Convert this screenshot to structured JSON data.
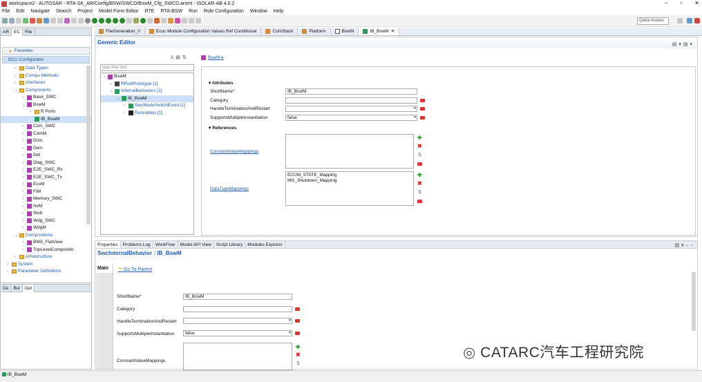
{
  "window": {
    "title": "workspace2 - AUTOSAR - RTA-SK_AR/Config/BSW/SWCD/BswM_Cfg_SWCD.arxml - ISOLAR-AB 4.0.2",
    "controls": [
      "–",
      "▫",
      "✕"
    ]
  },
  "menu": [
    "File",
    "Edit",
    "Navigate",
    "Search",
    "Project",
    "Model Form Editor",
    "RTE",
    "RTA-BSW",
    "Run",
    "Role Configuration",
    "Window",
    "Help"
  ],
  "toolbar": {
    "quick_access": "Quick Access"
  },
  "left": {
    "tabs": [
      "AR",
      "EC",
      "File"
    ],
    "favorites": "Favorites",
    "configurator": "ECU Configurator",
    "tree": [
      {
        "label": "Data Types",
        "kind": "folder",
        "lvl": 2
      },
      {
        "label": "Compu Methods",
        "kind": "folder",
        "lvl": 2
      },
      {
        "label": "Interfaces",
        "kind": "folder",
        "lvl": 2
      },
      {
        "label": "Components",
        "kind": "folder",
        "lvl": 2
      },
      {
        "label": "Base_SWC",
        "kind": "comp",
        "lvl": 3
      },
      {
        "label": "BswM",
        "kind": "comp",
        "lvl": 3
      },
      {
        "label": "R Ports",
        "kind": "folder",
        "lvl": 4
      },
      {
        "label": "IB_BswM",
        "kind": "ib",
        "lvl": 4,
        "sel": true
      },
      {
        "label": "Com_SWC",
        "kind": "comp",
        "lvl": 3
      },
      {
        "label": "ComM",
        "kind": "comp",
        "lvl": 3
      },
      {
        "label": "Dcm",
        "kind": "comp",
        "lvl": 3
      },
      {
        "label": "Dem",
        "kind": "comp",
        "lvl": 3
      },
      {
        "label": "Det",
        "kind": "comp",
        "lvl": 3
      },
      {
        "label": "Diag_SWC",
        "kind": "comp",
        "lvl": 3
      },
      {
        "label": "E2E_SWC_Rx",
        "kind": "comp",
        "lvl": 3
      },
      {
        "label": "E2E_SWC_Tx",
        "kind": "comp",
        "lvl": 3
      },
      {
        "label": "EcuM",
        "kind": "comp",
        "lvl": 3
      },
      {
        "label": "FIM",
        "kind": "comp",
        "lvl": 3
      },
      {
        "label": "Memory_SWC",
        "kind": "comp",
        "lvl": 3
      },
      {
        "label": "NvM",
        "kind": "comp",
        "lvl": 3
      },
      {
        "label": "Stub",
        "kind": "comp",
        "lvl": 3
      },
      {
        "label": "Wdg_SWC",
        "kind": "comp",
        "lvl": 3
      },
      {
        "label": "WdgM",
        "kind": "comp",
        "lvl": 3
      },
      {
        "label": "Compositions",
        "kind": "folder",
        "lvl": 2
      },
      {
        "label": "BMS_FlatView",
        "kind": "comp",
        "lvl": 3
      },
      {
        "label": "TopLevelCompositio",
        "kind": "comp",
        "lvl": 3
      },
      {
        "label": "Infrastructure",
        "kind": "folder",
        "lvl": 2
      },
      {
        "label": "System",
        "kind": "folder",
        "lvl": 1
      },
      {
        "label": "Parameter Definitions",
        "kind": "folder",
        "lvl": 1
      }
    ],
    "lower_tabs": [
      "De",
      "Bui",
      "Out"
    ]
  },
  "editor_tabs": [
    "FileGeneration_0",
    "Ecuc Module Configuration Values Ref Conditional",
    "ComStack",
    "Platform",
    "BswM",
    "IB_BswM"
  ],
  "ge": {
    "title": "Generic Editor",
    "filter_placeholder": "type filter text",
    "breadcrumb": "BswM",
    "tree": [
      {
        "label": "BswM",
        "lvl": 0
      },
      {
        "label": "RPortPrototype [1]",
        "lvl": 1
      },
      {
        "label": "InternalBehaviors [1]",
        "lvl": 1
      },
      {
        "label": "IB_BswM",
        "lvl": 2,
        "sel": true
      },
      {
        "label": "SwcModeSwitchEvent [1]",
        "lvl": 3
      },
      {
        "label": "Runnables [1]",
        "lvl": 3
      }
    ],
    "attributes": "Attributes",
    "references": "References",
    "short_name_label": "ShortName*",
    "short_name": "IB_BswM",
    "category_label": "Category",
    "handle_label": "HandleTerminationAndRestart",
    "supports_label": "SupportsMultipleInstantiation",
    "supports_value": "false",
    "cvm_label": "ConstantValueMappings",
    "dtm_label": "DataTypeMappings",
    "dtm_items": [
      "ECUM_STATE_Mapping",
      "MG_Shutdown_Mapping"
    ]
  },
  "props": {
    "tabs": [
      "Properties",
      "Problems Log",
      "WorkFlow",
      "Model API View",
      "Script Library",
      "Modules Explorer"
    ],
    "title": "SwcInternalBehavior : IB_BswM",
    "main_tab": "Main",
    "go_parent": "Go To Parent",
    "short_name_label": "ShortName*",
    "short_name": "IB_BswM",
    "category_label": "Category",
    "handle_label": "HandleTerminationAndRestart",
    "supports_label": "SupportsMultipleInstantiation",
    "supports_value": "false",
    "cvm_label": "ConstantValueMappings"
  },
  "status": "IB_BswM",
  "watermark": "CATARC汽车工程研究院"
}
